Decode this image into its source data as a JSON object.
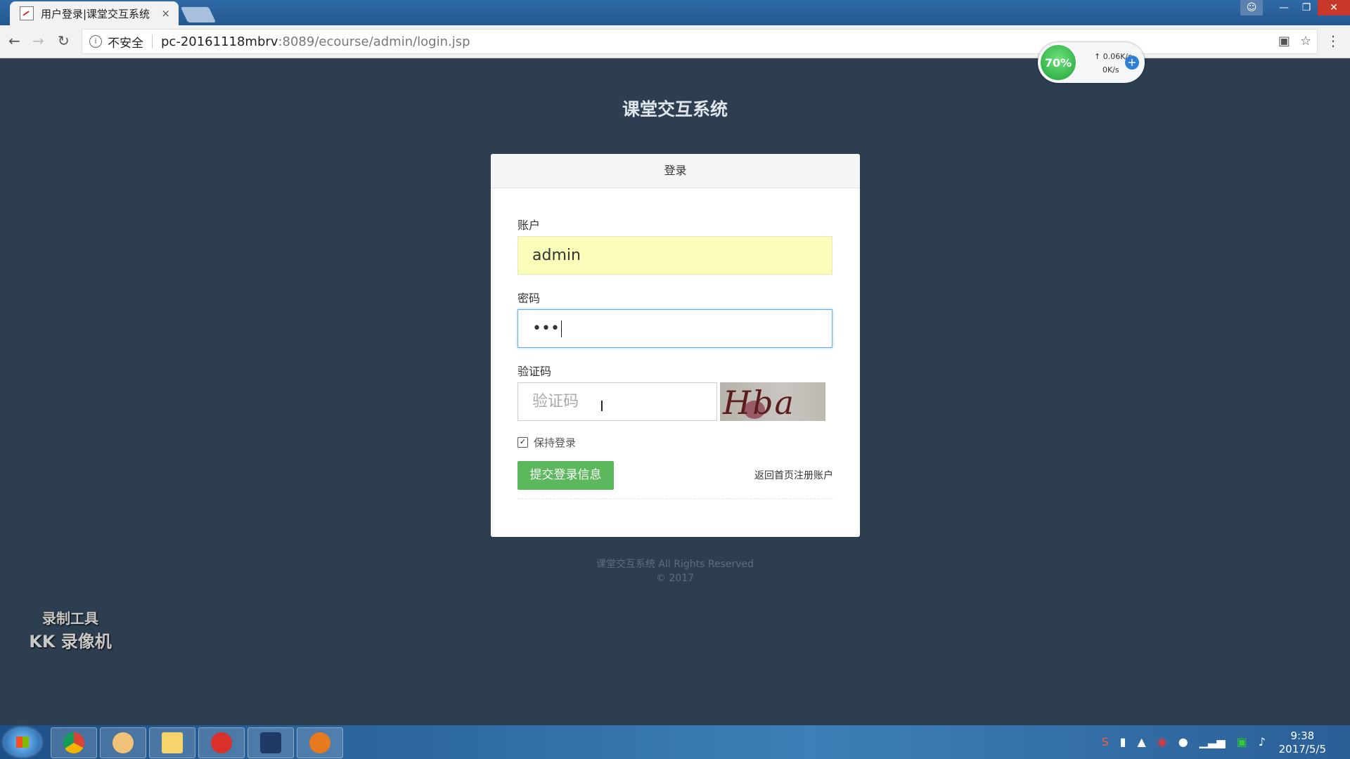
{
  "browser": {
    "tab_title": "用户登录|课堂交互系统",
    "tab_close": "×",
    "security_label": "不安全",
    "url_host": "pc-20161118mbrv",
    "url_rest": ":8089/ecourse/admin/login.jsp"
  },
  "speed_widget": {
    "percent": "70%",
    "up": "0.06K/s",
    "down": "0K/s"
  },
  "page": {
    "site_title": "课堂交互系统",
    "panel_title": "登录",
    "account_label": "账户",
    "account_value": "admin",
    "password_label": "密码",
    "password_value": "•••",
    "captcha_label": "验证码",
    "captcha_placeholder": "验证码",
    "captcha_text": "Hba",
    "remember_label": "保持登录",
    "remember_checked": true,
    "submit_label": "提交登录信息",
    "back_link": "返回首页注册账户",
    "footer_line1": "课堂交互系统 All Rights Reserved",
    "footer_line2": "© 2017"
  },
  "watermark": {
    "line1": "录制工具",
    "line2": "KK 录像机"
  },
  "taskbar": {
    "time": "9:38",
    "date": "2017/5/5"
  },
  "colors": {
    "page_bg": "#2c3e50",
    "submit_bg": "#5cb85c",
    "autofill_bg": "#fafdb8"
  }
}
